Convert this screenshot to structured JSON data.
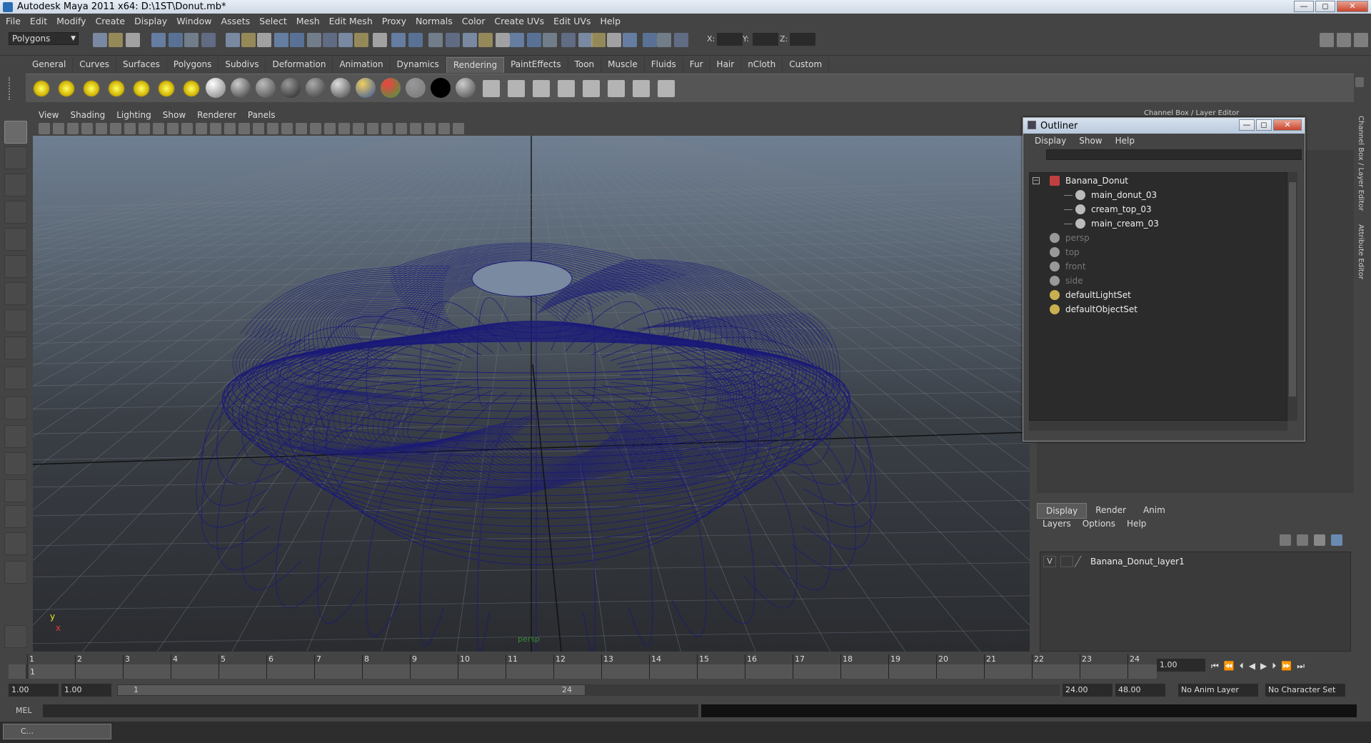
{
  "window": {
    "title": "Autodesk Maya 2011 x64: D:\\1ST\\Donut.mb*",
    "min": "—",
    "max": "◻",
    "close": "✕"
  },
  "menubar": [
    "File",
    "Edit",
    "Modify",
    "Create",
    "Display",
    "Window",
    "Assets",
    "Select",
    "Mesh",
    "Edit Mesh",
    "Proxy",
    "Normals",
    "Color",
    "Create UVs",
    "Edit UVs",
    "Help"
  ],
  "toolbar": {
    "mode": "Polygons",
    "x_label": "X:",
    "y_label": "Y:",
    "z_label": "Z:"
  },
  "shelf_tabs": [
    "General",
    "Curves",
    "Surfaces",
    "Polygons",
    "Subdivs",
    "Deformation",
    "Animation",
    "Dynamics",
    "Rendering",
    "PaintEffects",
    "Toon",
    "Muscle",
    "Fluids",
    "Fur",
    "Hair",
    "nCloth",
    "Custom"
  ],
  "active_shelf_tab": "Rendering",
  "viewport": {
    "menu": [
      "View",
      "Shading",
      "Lighting",
      "Show",
      "Renderer",
      "Panels"
    ],
    "camera_label": "persp",
    "axis_y": "y",
    "axis_x": "x",
    "wire_color": "#1a1a78"
  },
  "outliner": {
    "title": "Outliner",
    "menu": [
      "Display",
      "Show",
      "Help"
    ],
    "items": [
      {
        "label": "Banana_Donut",
        "depth": 0,
        "dim": false,
        "icon": "group-icon"
      },
      {
        "label": "main_donut_03",
        "depth": 1,
        "dim": false,
        "icon": "mesh-icon"
      },
      {
        "label": "cream_top_03",
        "depth": 1,
        "dim": false,
        "icon": "mesh-icon"
      },
      {
        "label": "main_cream_03",
        "depth": 1,
        "dim": false,
        "icon": "mesh-icon"
      },
      {
        "label": "persp",
        "depth": 0,
        "dim": true,
        "icon": "camera-icon"
      },
      {
        "label": "top",
        "depth": 0,
        "dim": true,
        "icon": "camera-icon"
      },
      {
        "label": "front",
        "depth": 0,
        "dim": true,
        "icon": "camera-icon"
      },
      {
        "label": "side",
        "depth": 0,
        "dim": true,
        "icon": "camera-icon"
      },
      {
        "label": "defaultLightSet",
        "depth": 0,
        "dim": false,
        "icon": "set-icon"
      },
      {
        "label": "defaultObjectSet",
        "depth": 0,
        "dim": false,
        "icon": "set-icon"
      }
    ]
  },
  "channel_box_title": "Channel Box / Layer Editor",
  "right_tabs": [
    "Channel Box / Layer Editor",
    "Attribute Editor"
  ],
  "layer_editor": {
    "tabs": [
      "Display",
      "Render",
      "Anim"
    ],
    "active_tab": "Display",
    "menu": [
      "Layers",
      "Options",
      "Help"
    ],
    "layers": [
      {
        "visible": "V",
        "name": "Banana_Donut_layer1"
      }
    ]
  },
  "timeline": {
    "ticks": [
      "1",
      "2",
      "3",
      "4",
      "5",
      "6",
      "7",
      "8",
      "9",
      "10",
      "11",
      "12",
      "13",
      "14",
      "15",
      "16",
      "17",
      "18",
      "19",
      "20",
      "21",
      "22",
      "23",
      "24"
    ],
    "current": "1",
    "current_time": "1.00"
  },
  "range": {
    "start": "1.00",
    "start2": "1.00",
    "slider_start": "1",
    "slider_end": "24",
    "end": "24.00",
    "end2": "48.00",
    "anim_layer": "No Anim Layer",
    "char_set": "No Character Set"
  },
  "mel_label": "MEL",
  "taskbar_label": "C..."
}
